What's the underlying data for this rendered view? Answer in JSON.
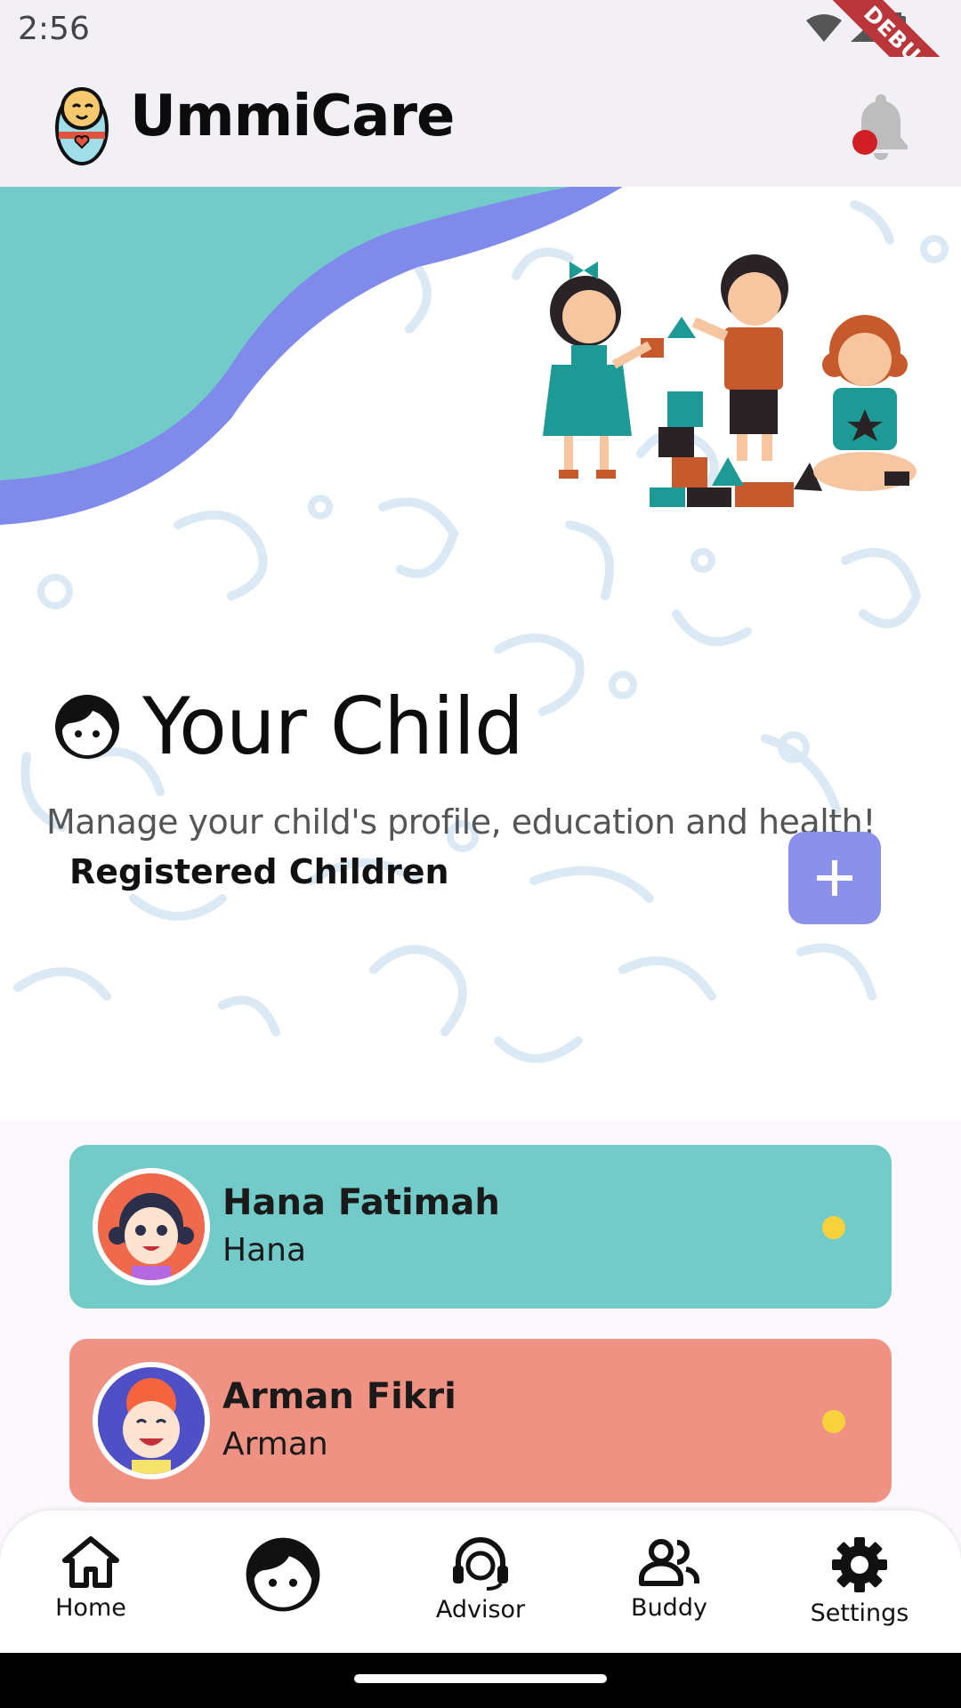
{
  "status_bar": {
    "time": "2:56",
    "debug_label": "DEBUG"
  },
  "app_bar": {
    "title": "UmmiCare",
    "logo_icon": "baby-swaddle-logo",
    "notification_icon": "bell-icon",
    "has_unread": true
  },
  "hero": {
    "illustration": "children-playing-blocks",
    "heading": "Your Child",
    "heading_icon": "child-face-icon",
    "subtitle": "Manage your child's profile, education and health!"
  },
  "children_section": {
    "label": "Registered Children",
    "add_button_icon": "plus-icon",
    "children": [
      {
        "name": "Hana Fatimah",
        "nickname": "Hana",
        "card_color": "#72cbc9",
        "avatar_bg": "#ef6a4c",
        "status_color": "#f7d23c"
      },
      {
        "name": "Arman Fikri",
        "nickname": "Arman",
        "card_color": "#f09283",
        "avatar_bg": "#4f4fc6",
        "status_color": "#f7d23c"
      }
    ]
  },
  "bottom_nav": {
    "items": [
      {
        "label": "Home",
        "icon": "home-icon"
      },
      {
        "label": "",
        "icon": "child-face-icon",
        "active": true
      },
      {
        "label": "Advisor",
        "icon": "headset-person-icon"
      },
      {
        "label": "Buddy",
        "icon": "people-icon"
      },
      {
        "label": "Settings",
        "icon": "gear-icon"
      }
    ]
  },
  "colors": {
    "accent": "#8b90ea",
    "teal": "#72cbc9",
    "salmon": "#f09283",
    "doodle": "#d6e8f5"
  }
}
